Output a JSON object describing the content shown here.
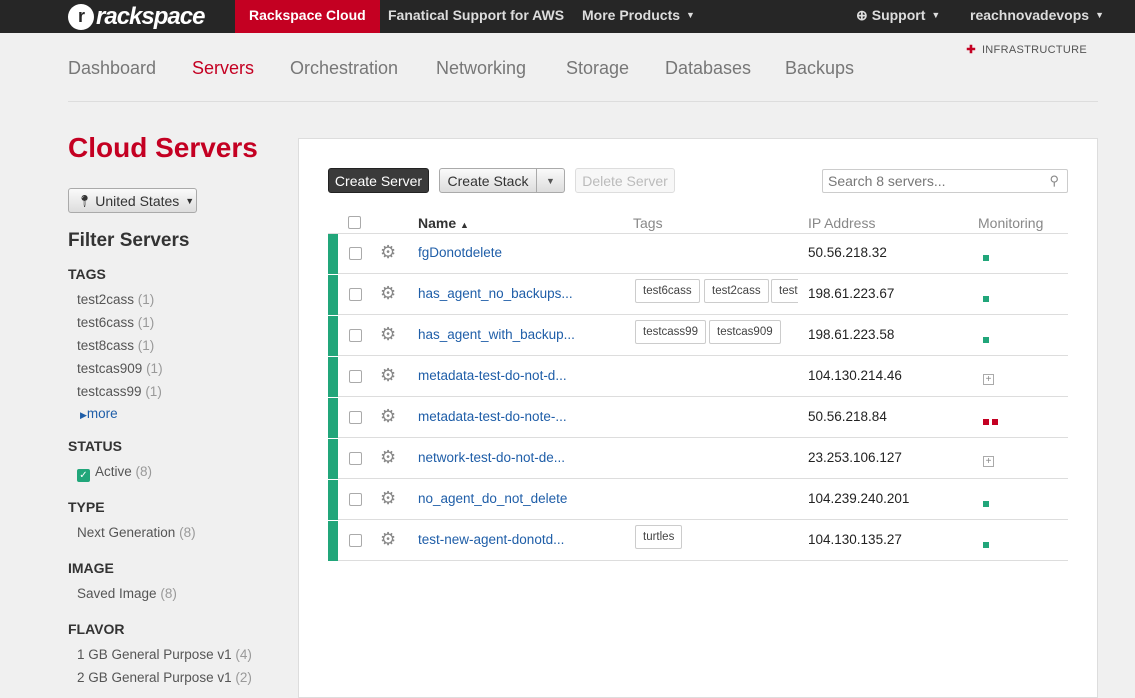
{
  "topbar": {
    "logo": "rackspace",
    "items": [
      "Rackspace Cloud",
      "Fanatical Support for AWS",
      "More Products"
    ],
    "support": "Support",
    "account": "reachnovadevops"
  },
  "infrastructure_label": "INFRASTRUCTURE",
  "subnav": [
    "Dashboard",
    "Servers",
    "Orchestration",
    "Networking",
    "Storage",
    "Databases",
    "Backups"
  ],
  "page_title": "Cloud Servers",
  "region": "United States",
  "filter": {
    "title": "Filter Servers",
    "tags_heading": "TAGS",
    "tags": [
      {
        "label": "test2cass",
        "count": "(1)"
      },
      {
        "label": "test6cass",
        "count": "(1)"
      },
      {
        "label": "test8cass",
        "count": "(1)"
      },
      {
        "label": "testcas909",
        "count": "(1)"
      },
      {
        "label": "testcass99",
        "count": "(1)"
      }
    ],
    "more": "more",
    "status_heading": "STATUS",
    "status": {
      "label": "Active",
      "count": "(8)"
    },
    "type_heading": "TYPE",
    "type": {
      "label": "Next Generation",
      "count": "(8)"
    },
    "image_heading": "IMAGE",
    "image": {
      "label": "Saved Image",
      "count": "(8)"
    },
    "flavor_heading": "FLAVOR",
    "flavors": [
      {
        "label": "1 GB General Purpose v1",
        "count": "(4)"
      },
      {
        "label": "2 GB General Purpose v1",
        "count": "(2)"
      }
    ]
  },
  "toolbar": {
    "create_server": "Create Server",
    "create_stack": "Create Stack",
    "delete_server": "Delete Server",
    "search_placeholder": "Search 8 servers..."
  },
  "table": {
    "headers": {
      "name": "Name",
      "tags": "Tags",
      "ip": "IP Address",
      "monitoring": "Monitoring"
    },
    "rows": [
      {
        "name": "fgDonotdelete",
        "tags": [],
        "ip": "50.56.218.32",
        "monitoring": "ok"
      },
      {
        "name": "has_agent_no_backups...",
        "tags": [
          "test6cass",
          "test2cass",
          "test"
        ],
        "ip": "198.61.223.67",
        "monitoring": "ok"
      },
      {
        "name": "has_agent_with_backup...",
        "tags": [
          "testcass99",
          "testcas909"
        ],
        "ip": "198.61.223.58",
        "monitoring": "ok"
      },
      {
        "name": "metadata-test-do-not-d...",
        "tags": [],
        "ip": "104.130.214.46",
        "monitoring": "none"
      },
      {
        "name": "metadata-test-do-note-...",
        "tags": [],
        "ip": "50.56.218.84",
        "monitoring": "critical"
      },
      {
        "name": "network-test-do-not-de...",
        "tags": [],
        "ip": "23.253.106.127",
        "monitoring": "none"
      },
      {
        "name": "no_agent_do_not_delete",
        "tags": [],
        "ip": "104.239.240.201",
        "monitoring": "ok"
      },
      {
        "name": "test-new-agent-donotd...",
        "tags": [
          "turtles"
        ],
        "ip": "104.130.135.27",
        "monitoring": "ok"
      }
    ]
  },
  "colors": {
    "brand": "#c40022",
    "status_active": "#21a67a",
    "link": "#1f5ea8"
  }
}
